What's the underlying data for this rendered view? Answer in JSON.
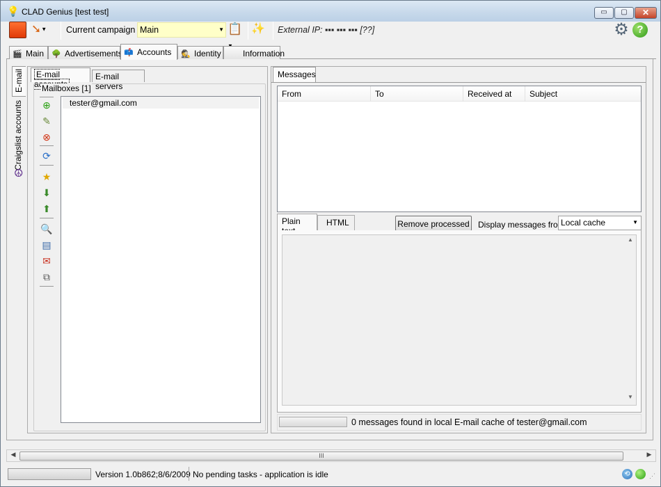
{
  "window": {
    "title": "CLAD Genius [test test]",
    "controls": {
      "minimize": "▭",
      "maximize": "▢",
      "close": "✕"
    }
  },
  "toolbar": {
    "campaign_label": "Current campaign",
    "campaign_value": "Main",
    "external_ip": "External IP: ▪▪▪ ▪▪▪ ▪▪▪ [??]"
  },
  "main_tabs": [
    {
      "label": "Main",
      "icon": "clapper-icon"
    },
    {
      "label": "Advertisements",
      "icon": "tree-icon"
    },
    {
      "label": "Accounts",
      "icon": "mailbox-icon",
      "active": true
    },
    {
      "label": "Identity",
      "icon": "spy-icon"
    },
    {
      "label": "Information",
      "icon": ""
    }
  ],
  "side_tabs": {
    "email": "E-mail",
    "craigslist": "Craigslist accounts"
  },
  "email_tabs": {
    "accounts": "E-mail accounts",
    "servers": "E-mail servers"
  },
  "mailboxes": {
    "title": "Mailboxes [1]",
    "items": [
      "tester@gmail.com"
    ]
  },
  "messages": {
    "tab": "Messages",
    "columns": [
      "From",
      "To",
      "Received at",
      "Subject"
    ],
    "rows": [],
    "body_tabs": [
      "Plain text",
      "HTML"
    ],
    "remove_button": "Remove processed",
    "display_label": "Display messages from",
    "display_value": "Local cache",
    "status": "0 messages found in local E-mail cache of tester@gmail.com"
  },
  "scrollbar": {
    "thumb_grip": "III"
  },
  "statusbar": {
    "version": "Version 1.0b862;8/6/2009",
    "task_status": "No pending tasks - application is idle"
  },
  "colors": {
    "campaign_bg": "#ffffc8",
    "accent": "#2e9a18"
  }
}
